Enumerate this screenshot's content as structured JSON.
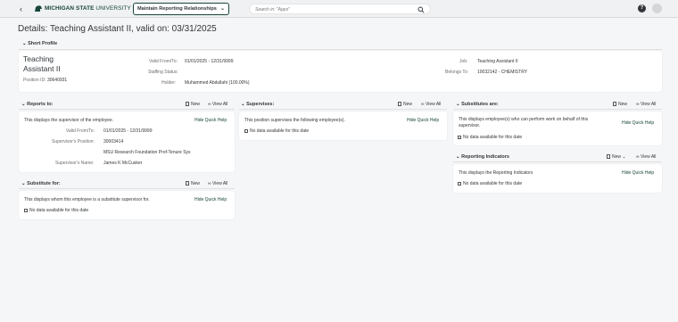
{
  "shell": {
    "back_icon": "back-arrow-icon",
    "logo_icon": "spartan-helmet-icon",
    "university_bold": "MICHIGAN STATE",
    "university_light": " UNIVERSITY",
    "app_title": "Maintain Reporting Relationships",
    "search_placeholder": "Search in: \"Apps\"",
    "help_label": "?"
  },
  "page": {
    "title": "Details: Teaching Assistant II, valid on: 03/31/2025"
  },
  "short_profile": {
    "header": "Short Profile",
    "name_line1": "Teaching",
    "name_line2": "Assistant II",
    "position_id_label": "Position ID:",
    "position_id": "30640931",
    "valid_label": "Valid From/To:",
    "valid_value": "01/01/2025 - 12/31/9999",
    "staffing_label": "Staffing Status:",
    "staffing_value": "",
    "holder_label": "Holder:",
    "holder_value": "Muhammed Abdullahi (100.00%)",
    "job_label": "Job:",
    "job_value": "Teaching Assistant II",
    "belongs_label": "Belongs To:",
    "belongs_value": "10032142 - CHEMISTRY"
  },
  "reports_to": {
    "header": "Reports to:",
    "new_label": "New",
    "view_all_label": "View All",
    "description": "This displays the supervisor of the employee.",
    "hide_help": "Hide Quick Help",
    "valid_label": "Valid From/To:",
    "valid_value": "01/01/2025 - 12/31/9999",
    "sup_pos_label": "Supervisor's Position:",
    "sup_pos_value": "30003414",
    "sup_pos_desc": "MSU Research Foundation Prof-Tenure Sys",
    "sup_name_label": "Supervisor's Name:",
    "sup_name_value": "James K McCusker"
  },
  "substitute_for": {
    "header": "Substitute for:",
    "new_label": "New",
    "view_all_label": "View All",
    "description": "This displays whom this employee is a substitute supervisor for.",
    "hide_help": "Hide Quick Help",
    "no_data": "No data available for this date"
  },
  "supervises": {
    "header": "Supervises:",
    "new_label": "New",
    "view_all_label": "View All",
    "description": "This position supervises the following employee(s).",
    "hide_help": "Hide Quick Help",
    "no_data": "No data available for this date"
  },
  "substitutes_are": {
    "header": "Substitutes are:",
    "new_label": "New",
    "view_all_label": "View All",
    "description_line1": "This displays employee(s) who can perform work on behalf of this",
    "description_line2": "supervisor.",
    "hide_help": "Hide Quick Help",
    "no_data": "No data available for this date"
  },
  "reporting_indicators": {
    "header": "Reporting Indicators",
    "new_label": "New",
    "view_all_label": "View All",
    "description": "This displays the Reporting Indicators",
    "hide_help": "Hide Quick Help",
    "no_data": "No data available for this date"
  },
  "colors": {
    "brand_green": "#18453b",
    "link_blue": "#0a6ed1",
    "background": "#f5f6f7"
  }
}
